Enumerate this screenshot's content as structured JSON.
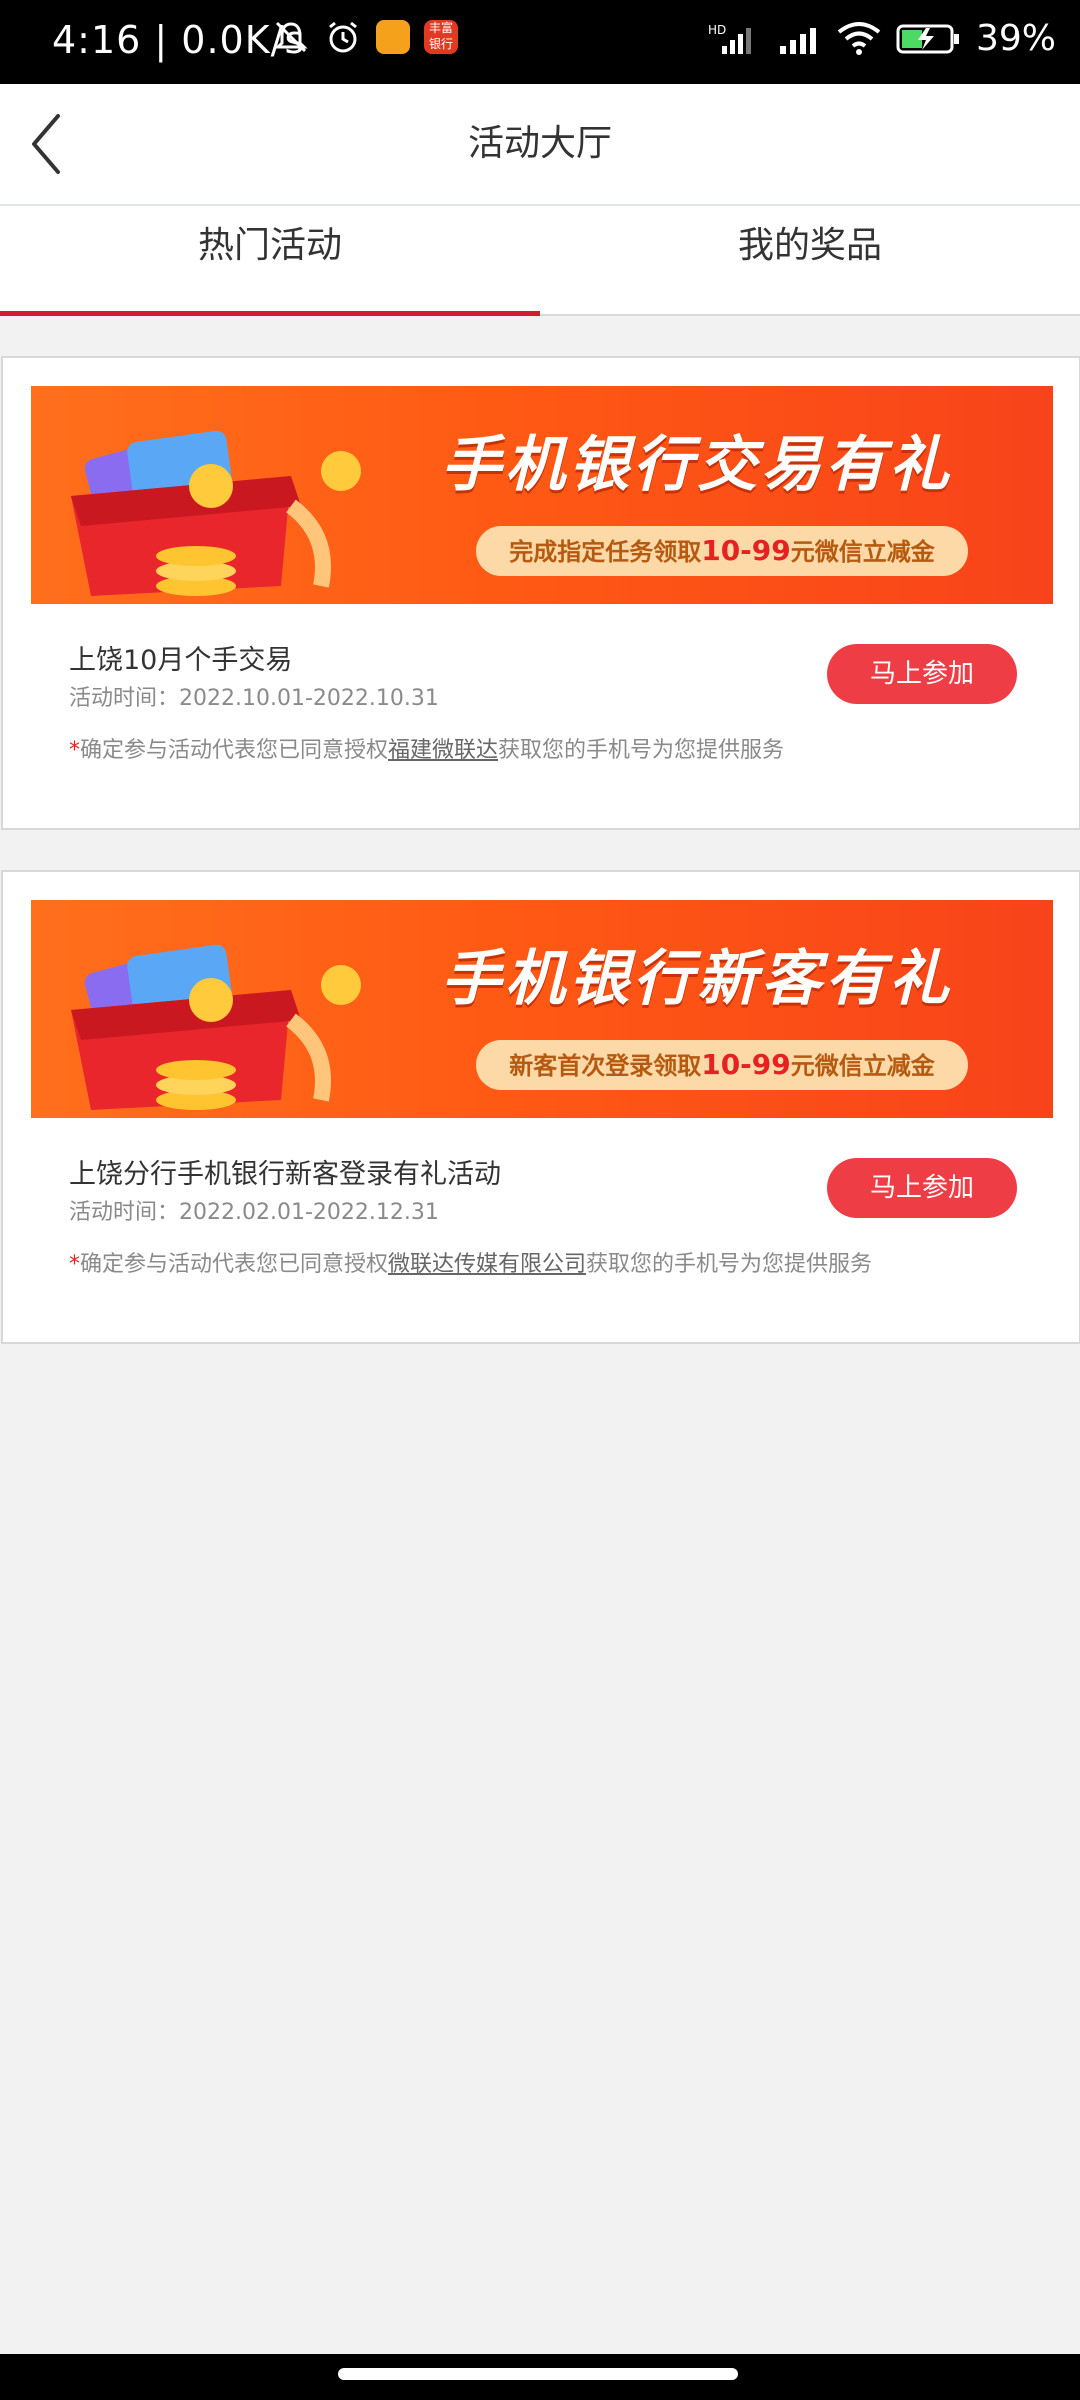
{
  "status_bar": {
    "time": "4:16 | 0.0K/s",
    "battery": "39%",
    "app_badge_text": "丰富银行"
  },
  "header": {
    "title": "活动大厅"
  },
  "tabs": [
    {
      "label": "热门活动",
      "active": true
    },
    {
      "label": "我的奖品",
      "active": false
    }
  ],
  "activities": [
    {
      "banner_title": "手机银行交易有礼",
      "banner_sub_prefix": "完成指定任务领取",
      "banner_sub_highlight": "10-99",
      "banner_sub_suffix": "元微信立减金",
      "title": "上饶10月个手交易",
      "time": "活动时间：2022.10.01-2022.10.31",
      "notice_prefix": "确定参与活动代表您已同意授权",
      "notice_link": "福建微联达",
      "notice_suffix": "获取您的手机号为您提供服务",
      "button": "马上参加"
    },
    {
      "banner_title": "手机银行新客有礼",
      "banner_sub_prefix": "新客首次登录领取",
      "banner_sub_highlight": "10-99",
      "banner_sub_suffix": "元微信立减金",
      "title": "上饶分行手机银行新客登录有礼活动",
      "time": "活动时间：2022.02.01-2022.12.31",
      "notice_prefix": "确定参与活动代表您已同意授权",
      "notice_link": "微联达传媒有限公司",
      "notice_suffix": "获取您的手机号为您提供服务",
      "button": "马上参加"
    }
  ],
  "colors": {
    "accent": "#cf1f2e",
    "button": "#ef3d45",
    "banner": "#ff5a14"
  }
}
